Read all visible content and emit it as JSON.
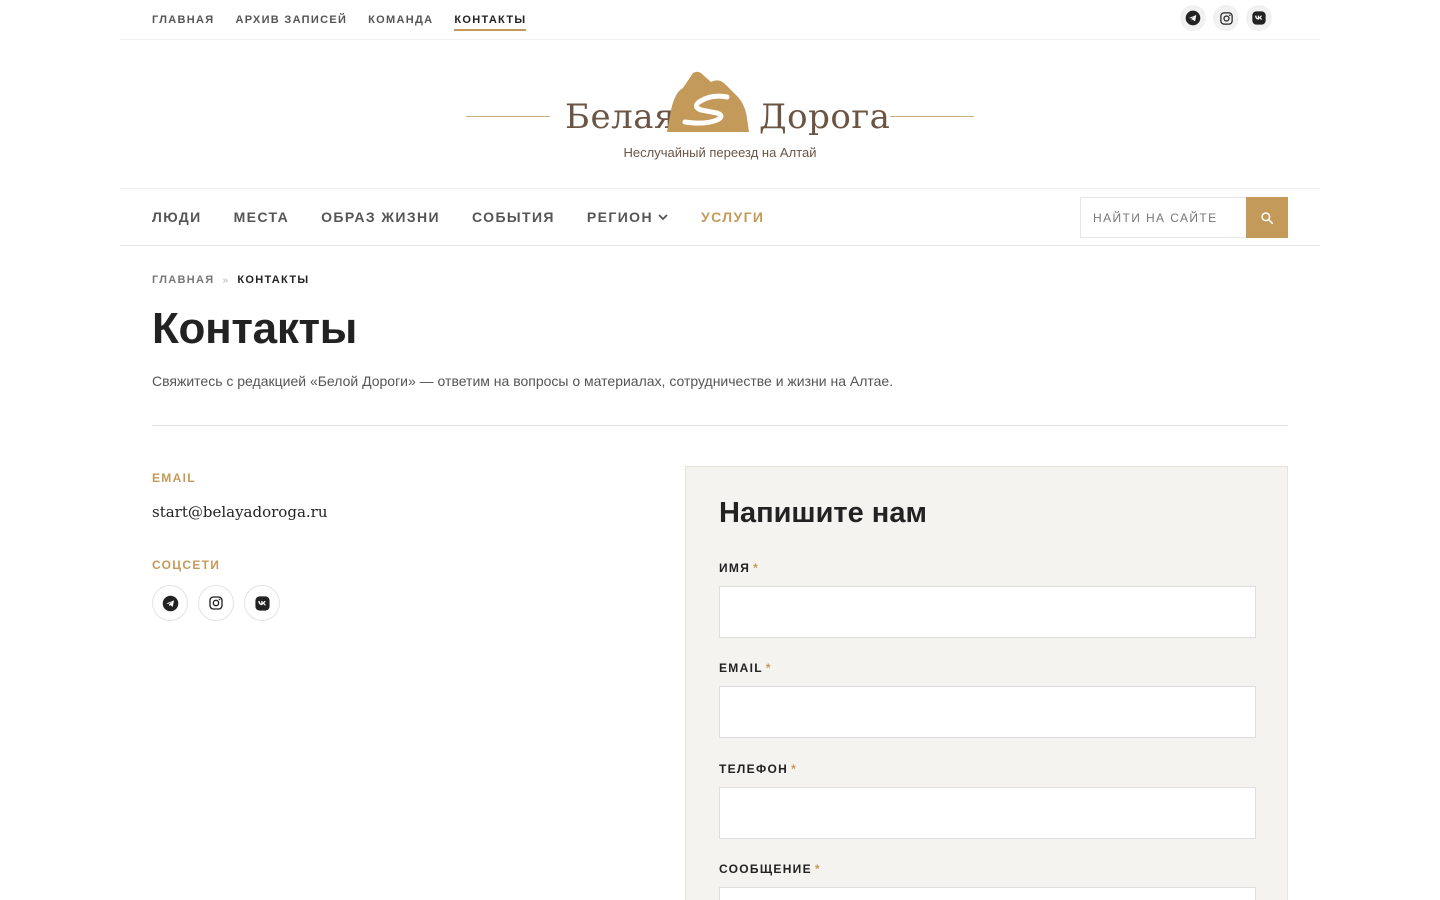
{
  "top_nav": [
    {
      "label": "Главная",
      "active": false
    },
    {
      "label": "Архив записей",
      "active": false
    },
    {
      "label": "Команда",
      "active": false
    },
    {
      "label": "Контакты",
      "active": true
    }
  ],
  "social_icons": [
    "telegram-icon",
    "instagram-icon",
    "vk-icon"
  ],
  "logo": {
    "word_left": "Белая",
    "word_right": "Дорога",
    "tagline": "Неслучайный переезд на Алтай"
  },
  "main_nav": [
    {
      "label": "Люди"
    },
    {
      "label": "Места"
    },
    {
      "label": "Образ жизни"
    },
    {
      "label": "События"
    },
    {
      "label": "Регион",
      "has_dropdown": true
    },
    {
      "label": "Услуги",
      "accent": true
    }
  ],
  "search": {
    "placeholder": "НАЙТИ НА САЙТЕ"
  },
  "breadcrumb": {
    "home": "Главная",
    "separator": "»",
    "current": "Контакты"
  },
  "page": {
    "title": "Контакты",
    "lead": "Свяжитесь с редакцией «Белой Дороги» — ответим на вопросы о материалах, сотрудничестве и жизни на Алтае."
  },
  "contacts": {
    "email_label": "Email",
    "email_value": "start@belayadoroga.ru",
    "social_label": "Соцсети"
  },
  "form": {
    "title": "Напишите нам",
    "required_mark": "*",
    "fields": [
      {
        "label": "Имя"
      },
      {
        "label": "Email"
      },
      {
        "label": "Телефон"
      },
      {
        "label": "Сообщение"
      }
    ]
  },
  "colors": {
    "accent": "#c49a5a",
    "logo_brown": "#6b5444",
    "panel_bg": "#f5f3ef"
  }
}
